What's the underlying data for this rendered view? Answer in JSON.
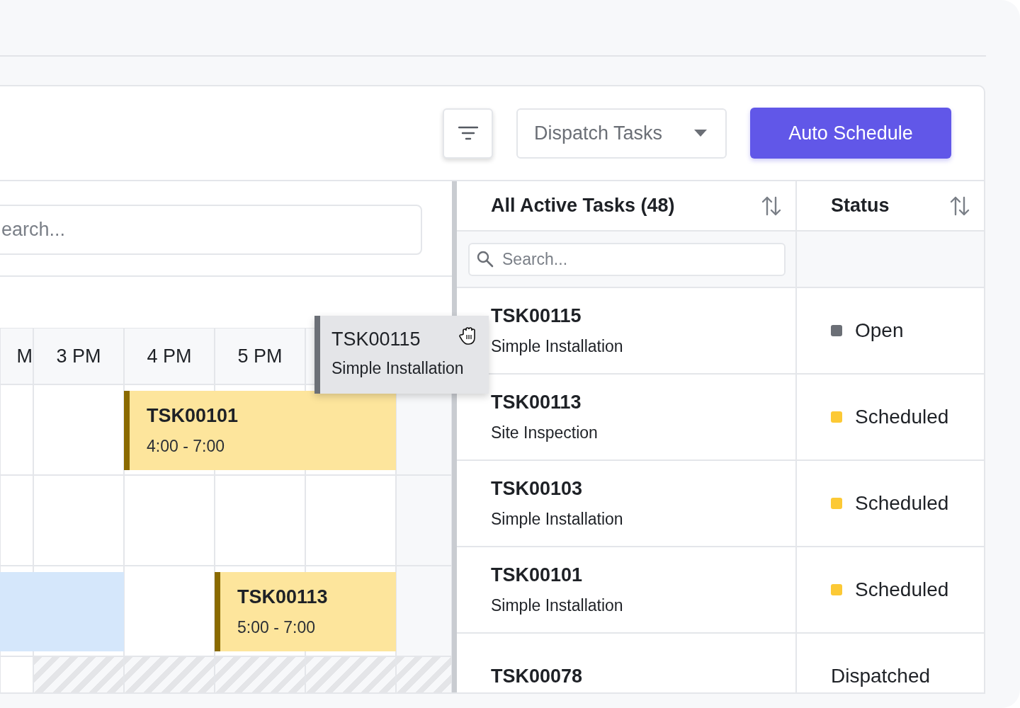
{
  "toolbar": {
    "dispatch_select": {
      "value": "Dispatch Tasks"
    },
    "auto_schedule_button": "Auto Schedule"
  },
  "scheduler": {
    "search": {
      "placeholder": "earch..."
    },
    "time_columns": [
      "M",
      "3 PM",
      "4 PM",
      "5 PM"
    ],
    "events": [
      {
        "id": "TSK00101",
        "time": "4:00 - 7:00",
        "kind": "scheduled"
      },
      {
        "id": "TSK00113",
        "time": "5:00 - 7:00",
        "kind": "scheduled"
      }
    ],
    "dragged_task": {
      "id": "TSK00115",
      "type": "Simple Installation"
    }
  },
  "task_table": {
    "columns": [
      "All Active Tasks (48)",
      "Status"
    ],
    "search": {
      "placeholder": "Search..."
    },
    "rows": [
      {
        "id": "TSK00115",
        "type": "Simple Installation",
        "status": "Open",
        "color": "#6b6f76"
      },
      {
        "id": "TSK00113",
        "type": "Site Inspection",
        "status": "Scheduled",
        "color": "#fcc935"
      },
      {
        "id": "TSK00103",
        "type": "Simple Installation",
        "status": "Scheduled",
        "color": "#fcc935"
      },
      {
        "id": "TSK00101",
        "type": "Simple Installation",
        "status": "Scheduled",
        "color": "#fcc935"
      },
      {
        "id": "TSK00078",
        "status": "Dispatched"
      }
    ]
  }
}
